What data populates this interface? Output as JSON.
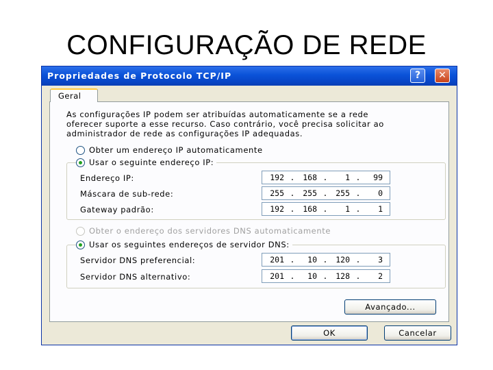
{
  "slide": {
    "title": "CONFIGURAÇÃO DE REDE"
  },
  "dialog": {
    "title": "Propriedades de Protocolo TCP/IP",
    "help_label": "?",
    "close_label": "✕",
    "tab_label": "Geral",
    "description_lines": [
      "As configurações IP podem ser atribuídas automaticamente se a rede",
      "oferecer suporte a esse recurso. Caso contrário, você precisa solicitar ao",
      "administrador de rede as configurações IP adequadas."
    ],
    "ip": {
      "auto_label": "Obter um endereço IP automaticamente",
      "manual_label": "Usar o seguinte endereço IP:",
      "selected": "manual",
      "fields": [
        {
          "label": "Endereço IP:",
          "octets": [
            "192",
            "168",
            "1",
            "99"
          ]
        },
        {
          "label": "Máscara de sub-rede:",
          "octets": [
            "255",
            "255",
            "255",
            "0"
          ]
        },
        {
          "label": "Gateway padrão:",
          "octets": [
            "192",
            "168",
            "1",
            "1"
          ]
        }
      ]
    },
    "dns": {
      "auto_label": "Obter o endereço dos servidores DNS automaticamente",
      "manual_label": "Usar os seguintes endereços de servidor DNS:",
      "selected": "manual",
      "fields": [
        {
          "label": "Servidor DNS preferencial:",
          "octets": [
            "201",
            "10",
            "120",
            "3"
          ]
        },
        {
          "label": "Servidor DNS alternativo:",
          "octets": [
            "201",
            "10",
            "128",
            "2"
          ]
        }
      ]
    },
    "buttons": {
      "advanced": "Avançado...",
      "ok": "OK",
      "cancel": "Cancelar"
    },
    "colors": {
      "titlebar": "#0a52d8",
      "dialog_bg": "#ece9d8",
      "selected_radio": "#21a121"
    }
  }
}
